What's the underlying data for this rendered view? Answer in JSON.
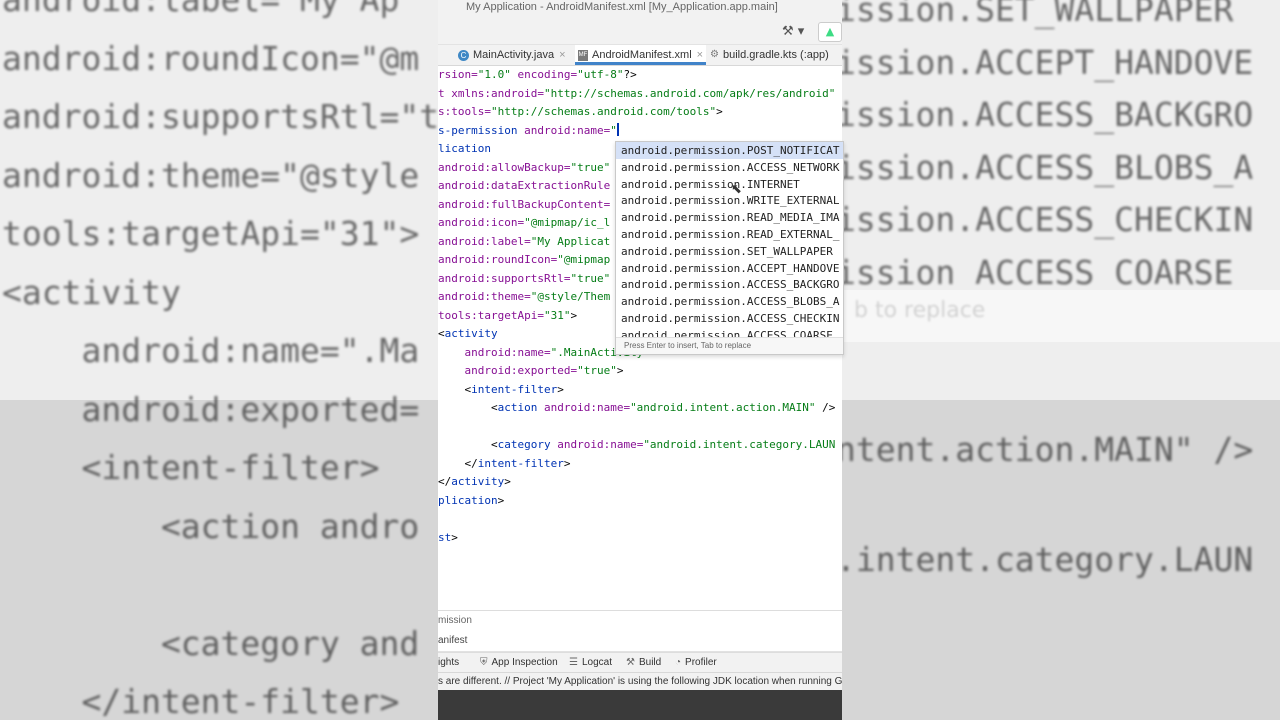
{
  "window": {
    "title": "My Application - AndroidManifest.xml [My_Application.app.main]"
  },
  "tabs": [
    {
      "label": "MainActivity.java",
      "icon": "java-class-icon",
      "active": false
    },
    {
      "label": "AndroidManifest.xml",
      "icon": "manifest-file-icon",
      "active": true
    },
    {
      "label": "build.gradle.kts (:app)",
      "icon": "gradle-icon",
      "active": false
    }
  ],
  "editor": {
    "lines": [
      {
        "parts": [
          [
            "k",
            "rsion="
          ],
          [
            "v",
            "\"1.0\""
          ],
          [
            "k",
            " encoding="
          ],
          [
            "v",
            "\"utf-8\""
          ],
          [
            "d",
            "?>"
          ]
        ]
      },
      {
        "parts": [
          [
            "k",
            "t xmlns:android="
          ],
          [
            "v",
            "\"http://schemas.android.com/apk/res/android\""
          ]
        ]
      },
      {
        "parts": [
          [
            "k",
            "s:tools="
          ],
          [
            "v",
            "\"http://schemas.android.com/tools\""
          ],
          [
            "d",
            ">"
          ]
        ]
      },
      {
        "parts": [
          [
            "t",
            "s-permission "
          ],
          [
            "k",
            "android:name="
          ],
          [
            "v",
            "\""
          ]
        ],
        "cursor": true
      },
      {
        "parts": [
          [
            "t",
            "lication"
          ]
        ]
      },
      {
        "parts": [
          [
            "k",
            "android:allowBackup="
          ],
          [
            "v",
            "\"true\""
          ]
        ]
      },
      {
        "parts": [
          [
            "k",
            "android:dataExtractionRule"
          ]
        ]
      },
      {
        "parts": [
          [
            "k",
            "android:fullBackupContent="
          ]
        ]
      },
      {
        "parts": [
          [
            "k",
            "android:icon="
          ],
          [
            "v",
            "\"@mipmap/ic_l"
          ]
        ]
      },
      {
        "parts": [
          [
            "k",
            "android:label="
          ],
          [
            "v",
            "\"My Applicat"
          ]
        ]
      },
      {
        "parts": [
          [
            "k",
            "android:roundIcon="
          ],
          [
            "v",
            "\"@mipmap"
          ]
        ]
      },
      {
        "parts": [
          [
            "k",
            "android:supportsRtl="
          ],
          [
            "v",
            "\"true\""
          ]
        ]
      },
      {
        "parts": [
          [
            "k",
            "android:theme="
          ],
          [
            "v",
            "\"@style/Them"
          ]
        ]
      },
      {
        "parts": [
          [
            "k",
            "tools:targetApi="
          ],
          [
            "v",
            "\"31\""
          ],
          [
            "d",
            ">"
          ]
        ]
      },
      {
        "parts": [
          [
            "d",
            "<"
          ],
          [
            "t",
            "activity"
          ]
        ]
      },
      {
        "parts": [
          [
            "d",
            "    "
          ],
          [
            "k",
            "android:name="
          ],
          [
            "v",
            "\".MainActivity\""
          ]
        ]
      },
      {
        "parts": [
          [
            "d",
            "    "
          ],
          [
            "k",
            "android:exported="
          ],
          [
            "v",
            "\"true\""
          ],
          [
            "d",
            ">"
          ]
        ]
      },
      {
        "parts": [
          [
            "d",
            "    <"
          ],
          [
            "t",
            "intent-filter"
          ],
          [
            "d",
            ">"
          ]
        ]
      },
      {
        "parts": [
          [
            "d",
            "        <"
          ],
          [
            "t",
            "action "
          ],
          [
            "k",
            "android:name="
          ],
          [
            "v",
            "\"android.intent.action.MAIN\""
          ],
          [
            "d",
            " />"
          ]
        ]
      },
      {
        "parts": []
      },
      {
        "parts": [
          [
            "d",
            "        <"
          ],
          [
            "t",
            "category "
          ],
          [
            "k",
            "android:name="
          ],
          [
            "v",
            "\"android.intent.category.LAUN"
          ]
        ]
      },
      {
        "parts": [
          [
            "d",
            "    </"
          ],
          [
            "t",
            "intent-filter"
          ],
          [
            "d",
            ">"
          ]
        ]
      },
      {
        "parts": [
          [
            "d",
            "</"
          ],
          [
            "t",
            "activity"
          ],
          [
            "d",
            ">"
          ]
        ]
      },
      {
        "parts": [
          [
            "t",
            "plication"
          ],
          [
            "d",
            ">"
          ]
        ]
      },
      {
        "parts": []
      },
      {
        "parts": [
          [
            "t",
            "st"
          ],
          [
            "d",
            ">"
          ]
        ]
      }
    ]
  },
  "completion": {
    "items": [
      "android.permission.POST_NOTIFICAT",
      "android.permission.ACCESS_NETWORK",
      "android.permission.INTERNET",
      "android.permission.WRITE_EXTERNAL",
      "android.permission.READ_MEDIA_IMA",
      "android.permission.READ_EXTERNAL_",
      "android.permission.SET_WALLPAPER",
      "android.permission.ACCEPT_HANDOVE",
      "android.permission.ACCESS_BACKGRO",
      "android.permission.ACCESS_BLOBS_A",
      "android.permission.ACCESS_CHECKIN",
      "android.permission.ACCESS_COARSE_"
    ],
    "selected_index": 0,
    "footer": "Press Enter to insert, Tab to replace"
  },
  "breadcrumb": "mission",
  "bottom_tab": "anifest",
  "tool_windows": [
    {
      "label": "ights",
      "icon": ""
    },
    {
      "label": "App Inspection",
      "icon": "app-inspection-icon"
    },
    {
      "label": "Logcat",
      "icon": "logcat-icon"
    },
    {
      "label": "Build",
      "icon": "build-hammer-icon"
    },
    {
      "label": "Profiler",
      "icon": "profiler-icon"
    }
  ],
  "status_message": "s are different. // Project 'My Application' is using the following JDK location when running G",
  "background": {
    "left_lines": [
      "android:label=\"My Ap",
      "android:roundIcon=\"@m",
      "android:supportsRtl=\"t",
      "android:theme=\"@style",
      "tools:targetApi=\"31\">",
      "<activity",
      "    android:name=\".Ma",
      "    android:exported=",
      "    <intent-filter>",
      "        <action andro",
      "",
      "        <category and",
      "    </intent-filter>"
    ],
    "right_lines": [
      "ission.SET_WALLPAPER",
      "ission.ACCEPT_HANDOVE",
      "ission.ACCESS_BACKGRO",
      "ission.ACCESS_BLOBS_A",
      "ission.ACCESS_CHECKIN",
      "ission ACCESS COARSE",
      "b to replace",
      "",
      "ntent.action.MAIN\" />",
      "",
      ".intent.category.LAUN"
    ]
  }
}
